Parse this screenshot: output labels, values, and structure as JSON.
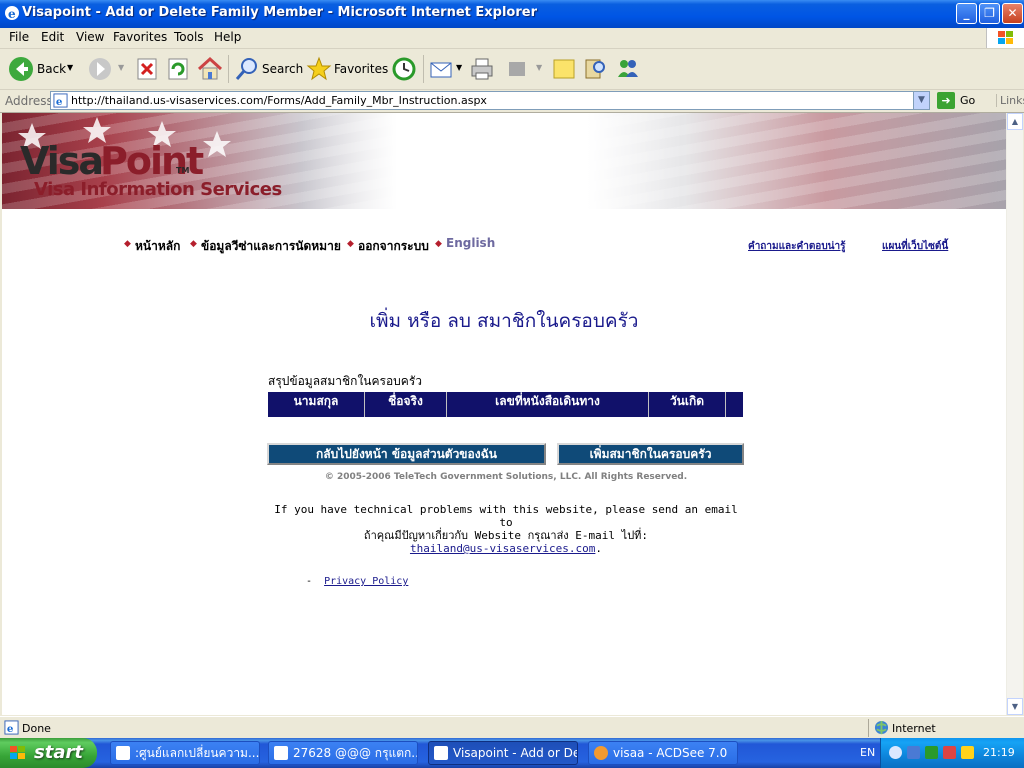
{
  "window": {
    "title": "Visapoint - Add or Delete Family Member - Microsoft Internet Explorer"
  },
  "menu": {
    "items": [
      "File",
      "Edit",
      "View",
      "Favorites",
      "Tools",
      "Help"
    ]
  },
  "toolbar": {
    "back": "Back",
    "search": "Search",
    "favorites": "Favorites"
  },
  "address": {
    "label": "Address",
    "url": "http://thailand.us-visaservices.com/Forms/Add_Family_Mbr_Instruction.aspx",
    "go": "Go",
    "links": "Links"
  },
  "banner": {
    "logo_visa": "Visa",
    "logo_point": "Point",
    "logo_tm": "TM",
    "subtitle": "Visa Information Services"
  },
  "nav": {
    "items": [
      "หน้าหลัก",
      "ข้อมูลวีซ่าและการนัดหมาย",
      "ออกจากระบบ",
      "English"
    ],
    "right_links": [
      "คำถามและคำตอบน่ารู้",
      "แผนที่เว็บไซต์นี้"
    ]
  },
  "main": {
    "heading": "เพิ่ม หรือ ลบ สมาชิกในครอบครัว",
    "summary_label": "สรุปข้อมูลสมาชิกในครอบครัว",
    "table_headers": [
      "นามสกุล",
      "ชื่อจริง",
      "เลขที่หนังสือเดินทาง",
      "วันเกิด",
      ""
    ],
    "btn_back": "กลับไปยังหน้า ข้อมูลส่วนตัวของฉัน",
    "btn_add": "เพิ่มสมาชิกในครอบครัว",
    "copyright": "© 2005-2006 TeleTech Government Solutions, LLC. All Rights Reserved.",
    "tech_en": "If you have technical problems with this website, please send an email to",
    "tech_th": "ถ้าคุณมีปัญหาเกี่ยวกับ Website กรุณาส่ง E-mail ไปที่:",
    "tech_email": "thailand@us-visaservices.com",
    "tech_period": ".",
    "privacy_dash": "-",
    "privacy": "Privacy Policy"
  },
  "status": {
    "text": "Done",
    "zone": "Internet"
  },
  "taskbar": {
    "start": "start",
    "tasks": [
      ":ศูนย์แลกเปลี่ยนความ...",
      "27628 @@@ กรุแตก....",
      "Visapoint - Add or Del...",
      "visaa - ACDSee 7.0"
    ],
    "lang": "EN",
    "clock": "21:19"
  },
  "colors": {
    "xp_blue": "#0055e5",
    "heading_blue": "#1a1a8c",
    "table_navy": "#11116a",
    "button_teal": "#0f4a78",
    "brand_red": "#8b1e2a"
  }
}
